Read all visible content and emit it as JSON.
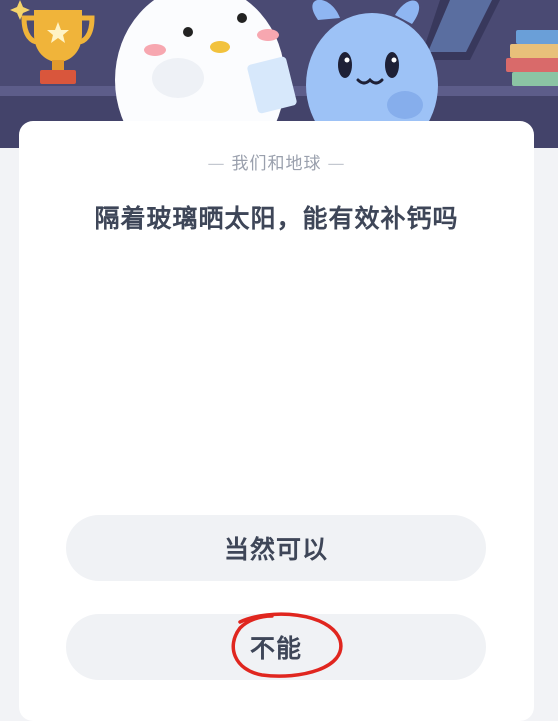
{
  "quiz": {
    "category": "我们和地球",
    "question": "隔着玻璃晒太阳，能有效补钙吗",
    "options": [
      {
        "label": "当然可以"
      },
      {
        "label": "不能"
      }
    ]
  },
  "colors": {
    "banner_bg": "#4a4a73",
    "card_bg": "#ffffff",
    "option_bg": "#f0f2f5",
    "text": "#3e4658",
    "subtitle": "#9aa0ad",
    "annotation": "#e0261f"
  }
}
